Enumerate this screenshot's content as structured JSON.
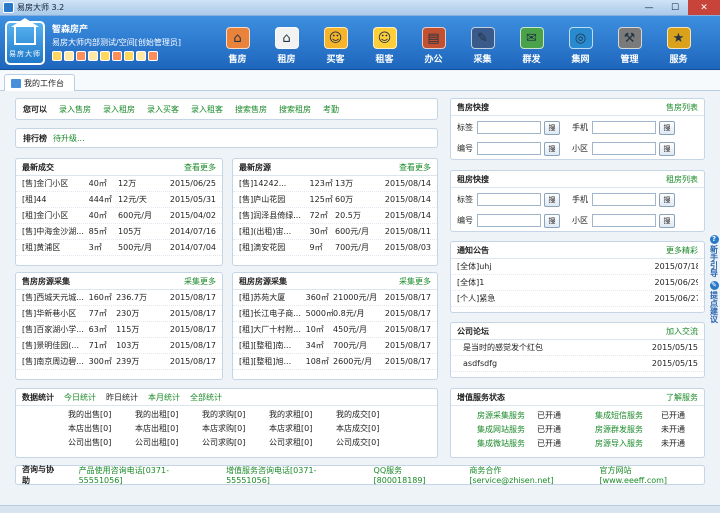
{
  "window": {
    "title": "易房大师 3.2",
    "min": "—",
    "max": "☐",
    "close": "✕"
  },
  "header": {
    "logo": "易房大师",
    "company": "智森房产",
    "subtitle": "易房大师内部测试/空间[创始管理员]",
    "nav": [
      {
        "label": "售房",
        "glyph": "⌂",
        "color": "#e9823a"
      },
      {
        "label": "租房",
        "glyph": "⌂",
        "color": "#f2f2f2"
      },
      {
        "label": "买客",
        "glyph": "☺",
        "color": "#f5b42a"
      },
      {
        "label": "租客",
        "glyph": "☺",
        "color": "#ffcf3a"
      },
      {
        "label": "办公",
        "glyph": "▤",
        "color": "#c25032"
      },
      {
        "label": "采集",
        "glyph": "✎",
        "color": "#3a5a8a"
      },
      {
        "label": "群发",
        "glyph": "✉",
        "color": "#4aa34a"
      },
      {
        "label": "集网",
        "glyph": "◎",
        "color": "#2a8ad0"
      },
      {
        "label": "管理",
        "glyph": "⚒",
        "color": "#7a7a7a"
      },
      {
        "label": "服务",
        "glyph": "★",
        "color": "#d9a21a"
      }
    ]
  },
  "tab": {
    "label": "我的工作台"
  },
  "quick": {
    "title": "您可以",
    "links": [
      "录入售房",
      "录入租房",
      "录入买客",
      "录入租客",
      "搜索售房",
      "搜索租房",
      "考勤"
    ]
  },
  "rank": {
    "title": "排行榜",
    "text": "待升级..."
  },
  "deals": {
    "title": "最新成交",
    "more": "查看更多",
    "rows": [
      {
        "name": "[售]金门小区",
        "area": "40㎡",
        "price": "12万",
        "date": "2015/06/25"
      },
      {
        "name": "[租]44",
        "area": "444㎡",
        "price": "12元/天",
        "date": "2015/05/31"
      },
      {
        "name": "[租]金门小区",
        "area": "40㎡",
        "price": "600元/月",
        "date": "2015/04/02"
      },
      {
        "name": "[售]中海金沙湖...",
        "area": "85㎡",
        "price": "105万",
        "date": "2014/07/16"
      },
      {
        "name": "[租]黄浦区",
        "area": "3㎡",
        "price": "500元/月",
        "date": "2014/07/04"
      }
    ]
  },
  "listings": {
    "title": "最新房源",
    "more": "查看更多",
    "rows": [
      {
        "name": "[售]14242...",
        "area": "123㎡",
        "price": "13万",
        "date": "2015/08/14"
      },
      {
        "name": "[售]庐山花园",
        "area": "125㎡",
        "price": "60万",
        "date": "2015/08/14"
      },
      {
        "name": "[售]润泽县倚绿...",
        "area": "72㎡",
        "price": "20.5万",
        "date": "2015/08/14"
      },
      {
        "name": "[租](出租)宙...",
        "area": "30㎡",
        "price": "600元/月",
        "date": "2015/08/11"
      },
      {
        "name": "[租]滴安花园",
        "area": "9㎡",
        "price": "700元/月",
        "date": "2015/08/03"
      }
    ]
  },
  "saleCollect": {
    "title": "售房房源采集",
    "more": "采集更多",
    "rows": [
      {
        "name": "[售]西城天元城...",
        "area": "160㎡",
        "price": "236.7万",
        "date": "2015/08/17"
      },
      {
        "name": "[售]华新巷小区",
        "area": "77㎡",
        "price": "230万",
        "date": "2015/08/17"
      },
      {
        "name": "[售]百家湖小学...",
        "area": "63㎡",
        "price": "115万",
        "date": "2015/08/17"
      },
      {
        "name": "[售]景明佳园(...",
        "area": "71㎡",
        "price": "103万",
        "date": "2015/08/17"
      },
      {
        "name": "[售]南京周边碧...",
        "area": "300㎡",
        "price": "239万",
        "date": "2015/08/17"
      }
    ]
  },
  "rentCollect": {
    "title": "租房房源采集",
    "more": "采集更多",
    "rows": [
      {
        "name": "[租]苏苑大厦",
        "area": "360㎡",
        "price": "21000元/月",
        "date": "2015/08/17"
      },
      {
        "name": "[租]长江电子商...",
        "area": "5000㎡",
        "price": "0.8元/月",
        "date": "2015/08/17"
      },
      {
        "name": "[租]大厂十村附...",
        "area": "10㎡",
        "price": "450元/月",
        "date": "2015/08/17"
      },
      {
        "name": "[租][整租]南...",
        "area": "34㎡",
        "price": "700元/月",
        "date": "2015/08/17"
      },
      {
        "name": "[租][整租]旭...",
        "area": "108㎡",
        "price": "2600元/月",
        "date": "2015/08/17"
      }
    ]
  },
  "saleSearch": {
    "title": "售房快搜",
    "more": "售房列表",
    "tag": "标签",
    "phone": "手机",
    "code": "编号",
    "estate": "小区",
    "btn": "搜"
  },
  "rentSearch": {
    "title": "租房快搜",
    "more": "租房列表",
    "tag": "标签",
    "phone": "手机",
    "code": "编号",
    "estate": "小区",
    "btn": "搜"
  },
  "notice": {
    "title": "通知公告",
    "more": "更多精彩",
    "rows": [
      {
        "text": "[全体]uhj",
        "date": "2015/07/18"
      },
      {
        "text": "[全体]1",
        "date": "2015/06/29"
      },
      {
        "text": "[个人]紧急",
        "date": "2015/06/27"
      }
    ]
  },
  "forum": {
    "title": "公司论坛",
    "more": "加入交流",
    "rows": [
      {
        "text": "是当时的感觉发个红包",
        "date": "2015/05/15"
      },
      {
        "text": "asdfsdfg",
        "date": "2015/05/15"
      }
    ]
  },
  "stats": {
    "title": "数据统计",
    "tabs": [
      "今日统计",
      "昨日统计",
      "本月统计",
      "全部统计"
    ],
    "cells": [
      "我的出售[0]",
      "我的出租[0]",
      "我的求购[0]",
      "我的求租[0]",
      "我的成交[0]",
      "本店出售[0]",
      "本店出租[0]",
      "本店求购[0]",
      "本店求租[0]",
      "本店成交[0]",
      "公司出售[0]",
      "公司出租[0]",
      "公司求购[0]",
      "公司求租[0]",
      "公司成交[0]"
    ]
  },
  "services": {
    "title": "增值服务状态",
    "more": "了解服务",
    "rows": [
      {
        "name": "房源采集服务",
        "status": "已开通",
        "name2": "集成短信服务",
        "status2": "已开通"
      },
      {
        "name": "集成网站服务",
        "status": "已开通",
        "name2": "房源群发服务",
        "status2": "未开通"
      },
      {
        "name": "集成微站服务",
        "status": "已开通",
        "name2": "房源导入服务",
        "status2": "未开通"
      }
    ]
  },
  "footer": {
    "title": "咨询与协助",
    "items": [
      "产品使用咨询电话[0371-55551056]",
      "增值服务咨询电话[0371-55551056]",
      "QQ服务[800018189]",
      "商务合作[service@zhisen.net]",
      "官方网站 [www.eeeff.com]"
    ]
  },
  "side": {
    "q": "?",
    "guide": "新手引导",
    "tip": "提点建议"
  }
}
